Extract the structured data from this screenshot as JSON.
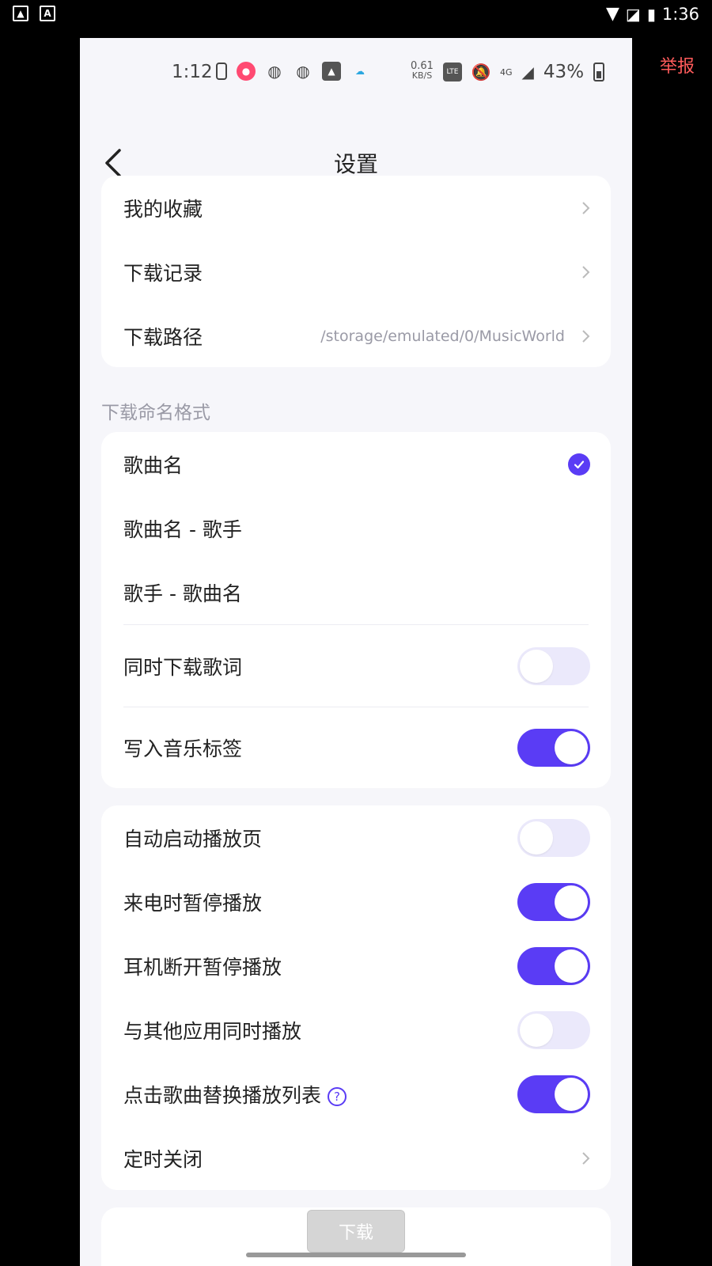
{
  "outer_status": {
    "time": "1:36"
  },
  "report": "举报",
  "inner_status": {
    "time": "1:12",
    "net_speed_value": "0.61",
    "net_speed_unit": "KB/S",
    "network": "4G",
    "battery": "43%"
  },
  "header": {
    "title": "设置"
  },
  "card1": {
    "favorites": "我的收藏",
    "download_history": "下载记录",
    "download_path": "下载路径",
    "download_path_value": "/storage/emulated/0/MusicWorld"
  },
  "naming_section_title": "下载命名格式",
  "card2": {
    "options": [
      "歌曲名",
      "歌曲名 - 歌手",
      "歌手 - 歌曲名"
    ],
    "selected_index": 0,
    "download_lyrics": {
      "label": "同时下载歌词",
      "on": false
    },
    "write_tags": {
      "label": "写入音乐标签",
      "on": true
    }
  },
  "card3": {
    "items": [
      {
        "label": "自动启动播放页",
        "on": false
      },
      {
        "label": "来电时暂停播放",
        "on": true
      },
      {
        "label": "耳机断开暂停播放",
        "on": true
      },
      {
        "label": "与其他应用同时播放",
        "on": false
      },
      {
        "label": "点击歌曲替换播放列表",
        "on": true
      }
    ],
    "sleep_timer": "定时关闭"
  },
  "download_button": "下载",
  "colors": {
    "accent": "#5a3cf5",
    "report": "#ff5b5b",
    "toggle_off": "#ebe9fb"
  }
}
